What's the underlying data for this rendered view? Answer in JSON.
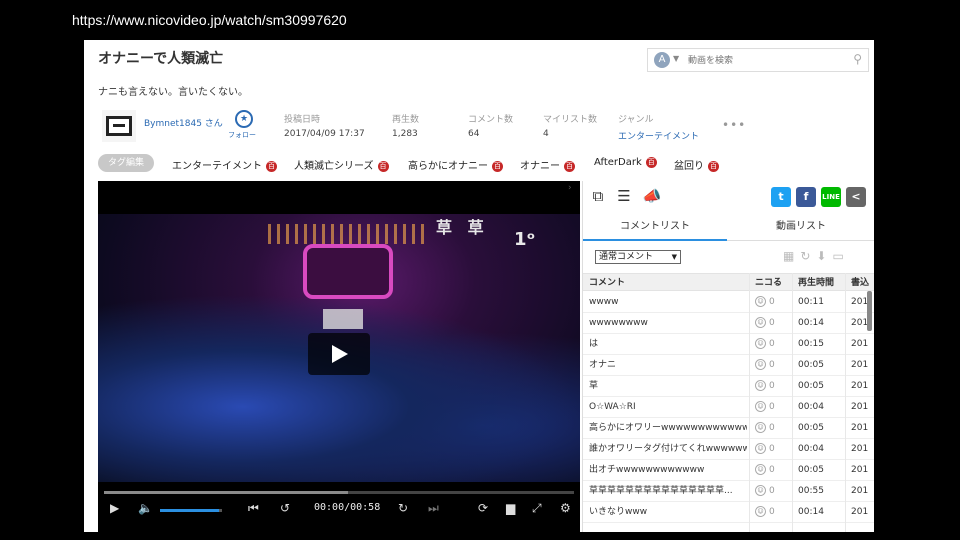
{
  "browser": {
    "url": "https://www.nicovideo.jp/watch/sm30997620"
  },
  "video": {
    "title": "オナニーで人類滅亡",
    "description": "ナニも言えない。言いたくない。"
  },
  "search": {
    "placeholder": "動画を検索",
    "engine_glyph": "A"
  },
  "uploader": {
    "name": "Bymnet1845 さん",
    "follow_label": "フォロー"
  },
  "stats": [
    {
      "label": "投稿日時",
      "value": "2017/04/09 17:37"
    },
    {
      "label": "再生数",
      "value": "1,283"
    },
    {
      "label": "コメント数",
      "value": "64"
    },
    {
      "label": "マイリスト数",
      "value": "4"
    },
    {
      "label": "ジャンル",
      "value": "エンターテイメント"
    }
  ],
  "more_label": "•••",
  "tags": {
    "edit_label": "タグ編集",
    "dic_glyph": "百",
    "items": [
      "エンターテイメント",
      "人類滅亡シリーズ",
      "高らかにオナニー",
      "オナニー",
      "AfterDark",
      "盆回り"
    ]
  },
  "player": {
    "overlay_comment": "草 草",
    "overlay_comment2": "1ᵒ",
    "timecode": "00:00/00:58",
    "progress": 0.52,
    "volume": 0.95
  },
  "panel": {
    "tabs": [
      "コメントリスト",
      "動画リスト"
    ],
    "filter": "通常コメント",
    "headers": [
      "コメント",
      "ニコる",
      "再生時間",
      "書込"
    ],
    "rows": [
      {
        "comment": "wwww",
        "nico": "0",
        "time": "00:11",
        "date": "201"
      },
      {
        "comment": "wwwwwwww",
        "nico": "0",
        "time": "00:14",
        "date": "201"
      },
      {
        "comment": "は",
        "nico": "0",
        "time": "00:15",
        "date": "201"
      },
      {
        "comment": "オナニ",
        "nico": "0",
        "time": "00:05",
        "date": "201"
      },
      {
        "comment": "草",
        "nico": "0",
        "time": "00:05",
        "date": "201"
      },
      {
        "comment": "O☆WA☆RI",
        "nico": "0",
        "time": "00:04",
        "date": "201"
      },
      {
        "comment": "高らかにオワリーwwwwwwwwwwww",
        "nico": "0",
        "time": "00:05",
        "date": "201"
      },
      {
        "comment": "誰かオワリータグ付けてくれwwwwww",
        "nico": "0",
        "time": "00:04",
        "date": "201"
      },
      {
        "comment": "出オチwwwwwwwwwwww",
        "nico": "0",
        "time": "00:05",
        "date": "201"
      },
      {
        "comment": "草草草草草草草草草草草草草草草...",
        "nico": "0",
        "time": "00:55",
        "date": "201"
      },
      {
        "comment": "いきなりwww",
        "nico": "0",
        "time": "00:14",
        "date": "201"
      }
    ]
  },
  "colors": {
    "link": "#2b6ab3",
    "accent": "#2b8fe0",
    "tag_dic": "#c62828",
    "twitter": "#1da1f2",
    "facebook": "#3b5998",
    "line": "#00b900",
    "share": "#666666"
  }
}
